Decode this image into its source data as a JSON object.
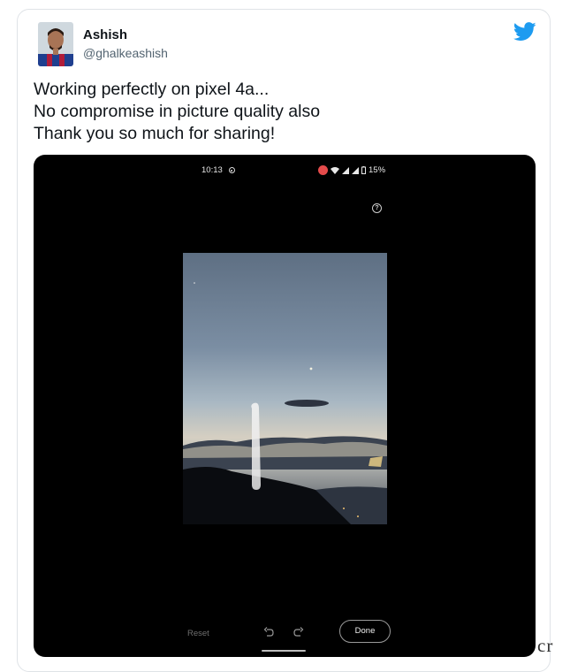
{
  "tweet": {
    "author_name": "Ashish",
    "author_handle": "@ghalkeashish",
    "text_lines": [
      "Working perfectly on pixel 4a...",
      "No compromise in picture quality also",
      "Thank you so much for sharing!"
    ]
  },
  "phone": {
    "status_time": "10:13",
    "battery": "15%",
    "help_glyph": "?",
    "reset_label": "Reset",
    "done_label": "Done"
  },
  "watermark": "cr",
  "colors": {
    "twitter_blue": "#1d9bf0",
    "media_background": "#000000",
    "text_primary": "#0f1419",
    "text_secondary": "#536471"
  },
  "icons": [
    "twitter-bird-icon",
    "undo-icon",
    "redo-icon",
    "help-icon",
    "wifi-icon",
    "signal-icon",
    "battery-icon"
  ]
}
